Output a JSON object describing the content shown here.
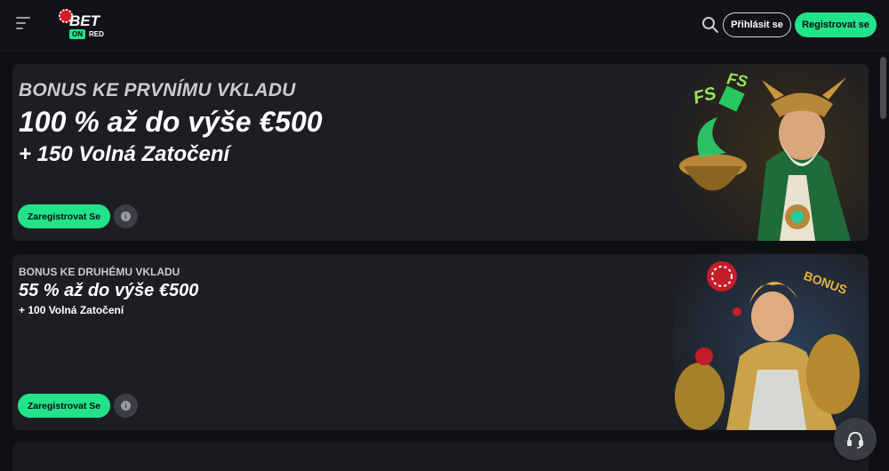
{
  "header": {
    "logo_text": "BET",
    "logo_on": "ON",
    "logo_red": "RED",
    "login_label": "Přihlásit se",
    "register_label": "Registrovat se"
  },
  "promos": [
    {
      "label": "BONUS KE PRVNÍMU VKLADU",
      "title": "100 % až do výše €500",
      "subtitle": "+ 150 Volná Zatočení",
      "cta_label": "Zaregistrovat Se",
      "art_text": "FS"
    },
    {
      "label": "BONUS KE DRUHÉMU VKLADU",
      "title": "55 % až do výše €500",
      "subtitle": "+ 100 Volná Zatočení",
      "cta_label": "Zaregistrovat Se",
      "art_text": "BONUS"
    }
  ],
  "colors": {
    "accent": "#21e38a",
    "background": "#0f1013",
    "card": "#1d1e23"
  },
  "icons": [
    "menu-icon",
    "search-icon",
    "info-icon",
    "headset-icon"
  ]
}
